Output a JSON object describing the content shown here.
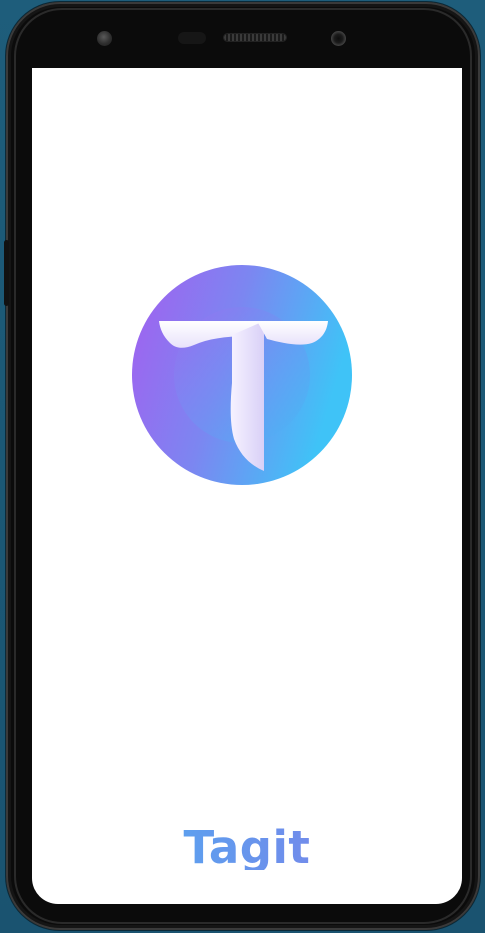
{
  "app": {
    "name": "Tagit"
  },
  "logo": {
    "icon": "tagit-logo-icon",
    "colors": {
      "gradient_start": "#a35ff0",
      "gradient_end": "#3fc3f7",
      "glyph": "#ffffff"
    }
  },
  "device": {
    "frame_color": "#0b0b0b",
    "background_color": "#1f5a76"
  }
}
